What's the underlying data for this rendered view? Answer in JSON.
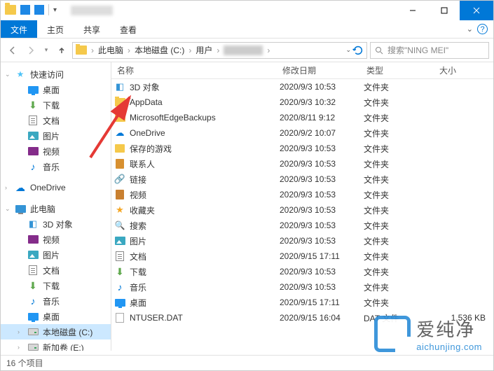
{
  "window": {
    "title_blur": true
  },
  "ribbon": {
    "file": "文件",
    "tabs": [
      "主页",
      "共享",
      "查看"
    ]
  },
  "breadcrumb": {
    "parts": [
      "此电脑",
      "本地磁盘 (C:)",
      "用户"
    ],
    "blur_after": true
  },
  "search": {
    "placeholder": "搜索\"NING MEI\""
  },
  "columns": {
    "name": "名称",
    "date": "修改日期",
    "type": "类型",
    "size": "大小"
  },
  "sidebar": {
    "quick": {
      "label": "快速访问",
      "items": [
        {
          "label": "桌面",
          "icon": "desktop"
        },
        {
          "label": "下载",
          "icon": "download"
        },
        {
          "label": "文档",
          "icon": "doc"
        },
        {
          "label": "图片",
          "icon": "pic"
        },
        {
          "label": "视频",
          "icon": "video"
        },
        {
          "label": "音乐",
          "icon": "music"
        }
      ]
    },
    "onedrive": {
      "label": "OneDrive"
    },
    "pc": {
      "label": "此电脑",
      "items": [
        {
          "label": "3D 对象",
          "icon": "3d"
        },
        {
          "label": "视频",
          "icon": "video"
        },
        {
          "label": "图片",
          "icon": "pic"
        },
        {
          "label": "文档",
          "icon": "doc"
        },
        {
          "label": "下载",
          "icon": "download"
        },
        {
          "label": "音乐",
          "icon": "music"
        },
        {
          "label": "桌面",
          "icon": "desktop"
        },
        {
          "label": "本地磁盘 (C:)",
          "icon": "drive",
          "selected": true
        },
        {
          "label": "新加卷 (E:)",
          "icon": "drive"
        }
      ]
    }
  },
  "files": [
    {
      "name": "3D 对象",
      "date": "2020/9/3 10:53",
      "type": "文件夹",
      "size": "",
      "icon": "3d"
    },
    {
      "name": "AppData",
      "date": "2020/9/3 10:32",
      "type": "文件夹",
      "size": "",
      "icon": "folder"
    },
    {
      "name": "MicrosoftEdgeBackups",
      "date": "2020/8/11 9:12",
      "type": "文件夹",
      "size": "",
      "icon": "folder"
    },
    {
      "name": "OneDrive",
      "date": "2020/9/2 10:07",
      "type": "文件夹",
      "size": "",
      "icon": "onedrive"
    },
    {
      "name": "保存的游戏",
      "date": "2020/9/3 10:53",
      "type": "文件夹",
      "size": "",
      "icon": "saved"
    },
    {
      "name": "联系人",
      "date": "2020/9/3 10:53",
      "type": "文件夹",
      "size": "",
      "icon": "contact"
    },
    {
      "name": "链接",
      "date": "2020/9/3 10:53",
      "type": "文件夹",
      "size": "",
      "icon": "link"
    },
    {
      "name": "视频",
      "date": "2020/9/3 10:53",
      "type": "文件夹",
      "size": "",
      "icon": "videofile"
    },
    {
      "name": "收藏夹",
      "date": "2020/9/3 10:53",
      "type": "文件夹",
      "size": "",
      "icon": "favstar"
    },
    {
      "name": "搜索",
      "date": "2020/9/3 10:53",
      "type": "文件夹",
      "size": "",
      "icon": "search"
    },
    {
      "name": "图片",
      "date": "2020/9/3 10:53",
      "type": "文件夹",
      "size": "",
      "icon": "pic"
    },
    {
      "name": "文档",
      "date": "2020/9/15 17:11",
      "type": "文件夹",
      "size": "",
      "icon": "doc"
    },
    {
      "name": "下载",
      "date": "2020/9/3 10:53",
      "type": "文件夹",
      "size": "",
      "icon": "download"
    },
    {
      "name": "音乐",
      "date": "2020/9/3 10:53",
      "type": "文件夹",
      "size": "",
      "icon": "music"
    },
    {
      "name": "桌面",
      "date": "2020/9/15 17:11",
      "type": "文件夹",
      "size": "",
      "icon": "desktop"
    },
    {
      "name": "NTUSER.DAT",
      "date": "2020/9/15 16:04",
      "type": "DAT 文件",
      "size": "1,536 KB",
      "icon": "dat"
    }
  ],
  "status": {
    "text": "16 个项目"
  },
  "watermark": {
    "cn": "爱纯净",
    "en": "aichunjing.com"
  }
}
